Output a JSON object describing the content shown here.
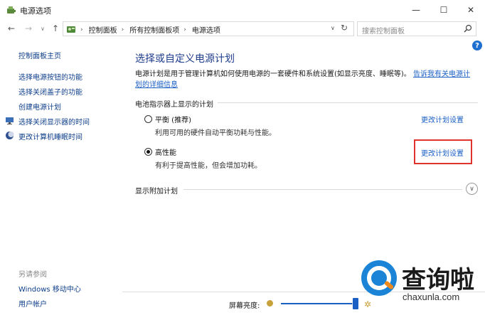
{
  "window": {
    "title": "电源选项",
    "min_glyph": "—",
    "max_glyph": "☐",
    "close_glyph": "✕"
  },
  "nav": {
    "back_glyph": "←",
    "forward_glyph": "→",
    "history_glyph": "∨",
    "up_glyph": "↑",
    "breadcrumbs": [
      "控制面板",
      "所有控制面板项",
      "电源选项"
    ],
    "crumb_sep": "›",
    "dropdown_glyph": "∨",
    "refresh_glyph": "↻",
    "search_placeholder": "搜索控制面板"
  },
  "sidebar": {
    "items": [
      {
        "label": "控制面板主页"
      },
      {
        "label": "选择电源按钮的功能"
      },
      {
        "label": "选择关闭盖子的功能"
      },
      {
        "label": "创建电源计划"
      },
      {
        "label": "选择关闭显示器的时间"
      },
      {
        "label": "更改计算机睡眠时间"
      }
    ],
    "see_also": "另请参阅",
    "see_also_items": [
      {
        "label": "Windows 移动中心"
      },
      {
        "label": "用户帐户"
      }
    ]
  },
  "main": {
    "help_glyph": "?",
    "title": "选择或自定义电源计划",
    "description": "电源计划是用于管理计算机如何使用电源的一套硬件和系统设置(如显示亮度、睡眠等)。",
    "description_link": "告诉我有关电源计划的详细信息",
    "section_label": "电池指示器上显示的计划",
    "plans": [
      {
        "name": "平衡 (推荐)",
        "desc": "利用可用的硬件自动平衡功耗与性能。",
        "change_label": "更改计划设置",
        "selected": false
      },
      {
        "name": "高性能",
        "desc": "有利于提高性能，但会增加功耗。",
        "change_label": "更改计划设置",
        "selected": true
      }
    ],
    "expand_label": "显示附加计划",
    "expand_glyph": "∨"
  },
  "brightness": {
    "label": "屏幕亮度:",
    "level_percent": 93,
    "sun_glyph": "✲"
  },
  "watermark": {
    "cn_text": "查询啦",
    "en_text": "chaxunla.com"
  },
  "colors": {
    "link": "#1a5fc4",
    "title": "#1e3c8c",
    "highlight": "#e0332b"
  }
}
